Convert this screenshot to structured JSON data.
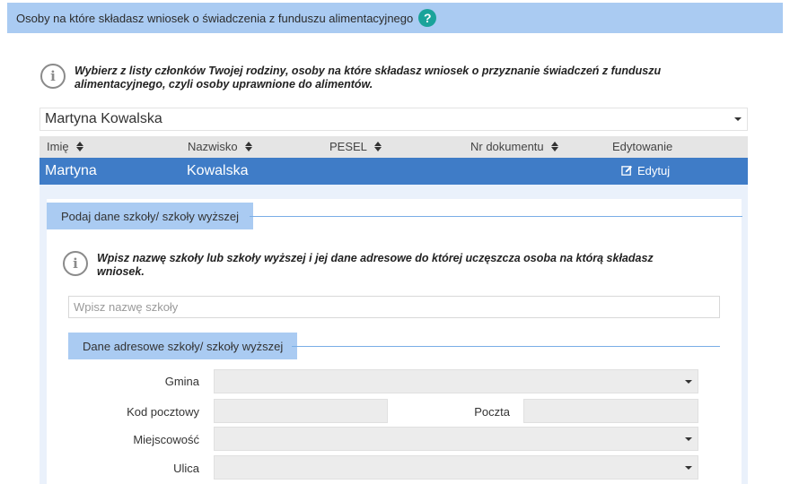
{
  "header": {
    "title": "Osoby na które składasz wniosek o świadczenia z funduszu alimentacyjnego",
    "help_icon": "?"
  },
  "info1": {
    "icon": "i",
    "line1": "Wybierz z listy członków Twojej rodziny, osoby na które składasz wniosek o przyznanie świadczeń z funduszu",
    "line2": "alimentacyjnego, czyli osoby uprawnione do alimentów."
  },
  "person_select": {
    "value": "Martyna Kowalska"
  },
  "table": {
    "columns": [
      "Imię",
      "Nazwisko",
      "PESEL",
      "Nr dokumentu",
      "Edytowanie"
    ],
    "rows": [
      {
        "first_name": "Martyna",
        "last_name": "Kowalska",
        "pesel": "",
        "document": "",
        "edit_label": "Edytuj"
      }
    ]
  },
  "school_section": {
    "tab_label": "Podaj dane szkoły/ szkoły wyższej",
    "info_icon": "i",
    "info_line1": "Wpisz nazwę szkoły lub szkoły wyższej i jej dane adresowe do której uczęszcza osoba na którą składasz",
    "info_line2": "wniosek.",
    "school_input_placeholder": "Wpisz nazwę szkoły",
    "school_input_value": ""
  },
  "address_section": {
    "tab_label": "Dane adresowe szkoły/ szkoły wyższej",
    "labels": {
      "gmina": "Gmina",
      "kod_pocztowy": "Kod pocztowy",
      "poczta": "Poczta",
      "miejscowosc": "Miejscowość",
      "ulica": "Ulica"
    },
    "values": {
      "gmina": "",
      "kod_pocztowy": "",
      "poczta": "",
      "miejscowosc": "",
      "ulica": ""
    }
  },
  "colors": {
    "header_bg": "#aacbf2",
    "help_icon": "#1aa39a",
    "selected_row": "#3f7cc7",
    "panel_bg": "#eaf1fb"
  }
}
